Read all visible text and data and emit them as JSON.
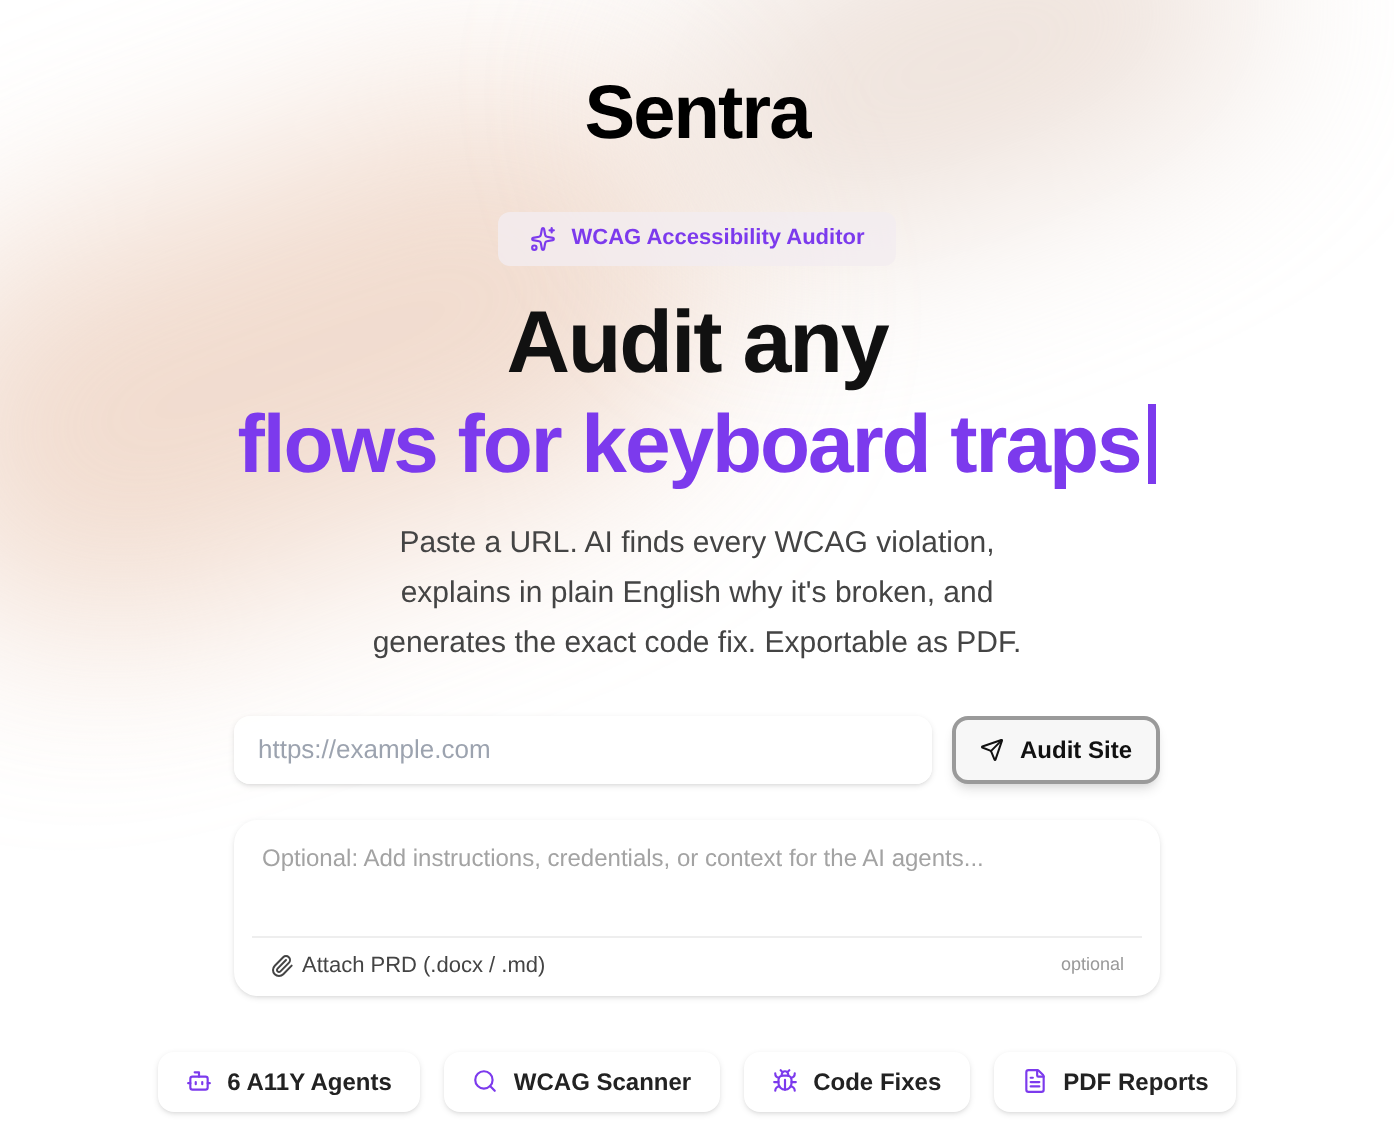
{
  "logo": "Sentra",
  "badge": "WCAG Accessibility Auditor",
  "headline": {
    "line_1": "Audit any",
    "line_2": "flows for keyboard traps"
  },
  "description": "Paste a URL. AI finds every WCAG violation, explains in plain English why it's broken, and generates the exact code fix. Exportable as PDF.",
  "url_field": {
    "placeholder": "https://example.com"
  },
  "audit_button": "Audit Site",
  "instructions_field": {
    "placeholder": "Optional: Add instructions, credentials, or context for the AI agents..."
  },
  "attach": {
    "label": "Attach PRD (.docx / .md)",
    "note": "optional"
  },
  "features": [
    {
      "kind": "agents",
      "label": "6 A11Y Agents"
    },
    {
      "kind": "scanner",
      "label": "WCAG Scanner"
    },
    {
      "kind": "fixes",
      "label": "Code Fixes"
    },
    {
      "kind": "reports",
      "label": "PDF Reports"
    }
  ]
}
